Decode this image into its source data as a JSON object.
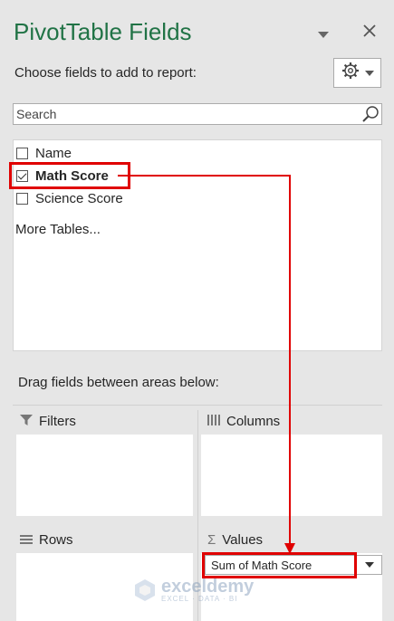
{
  "header": {
    "title": "PivotTable Fields",
    "subtitle": "Choose fields to add to report:"
  },
  "search": {
    "placeholder": "Search"
  },
  "fields": [
    {
      "label": "Name",
      "checked": false
    },
    {
      "label": "Math Score",
      "checked": true
    },
    {
      "label": "Science Score",
      "checked": false
    }
  ],
  "more_tables": "More Tables...",
  "drag_instructions": "Drag fields between areas below:",
  "areas": {
    "filters": "Filters",
    "columns": "Columns",
    "rows": "Rows",
    "values": "Values",
    "values_items": [
      "Sum of Math Score"
    ]
  },
  "watermark": {
    "name": "exceldemy",
    "tagline": "EXCEL · DATA · BI"
  },
  "colors": {
    "title": "#217346",
    "highlight": "#e00000",
    "panel": "#e6e6e6"
  },
  "icons": [
    "dropdown-arrow-icon",
    "close-icon",
    "gear-icon",
    "search-icon",
    "filter-icon",
    "columns-icon",
    "rows-icon",
    "sigma-icon"
  ]
}
